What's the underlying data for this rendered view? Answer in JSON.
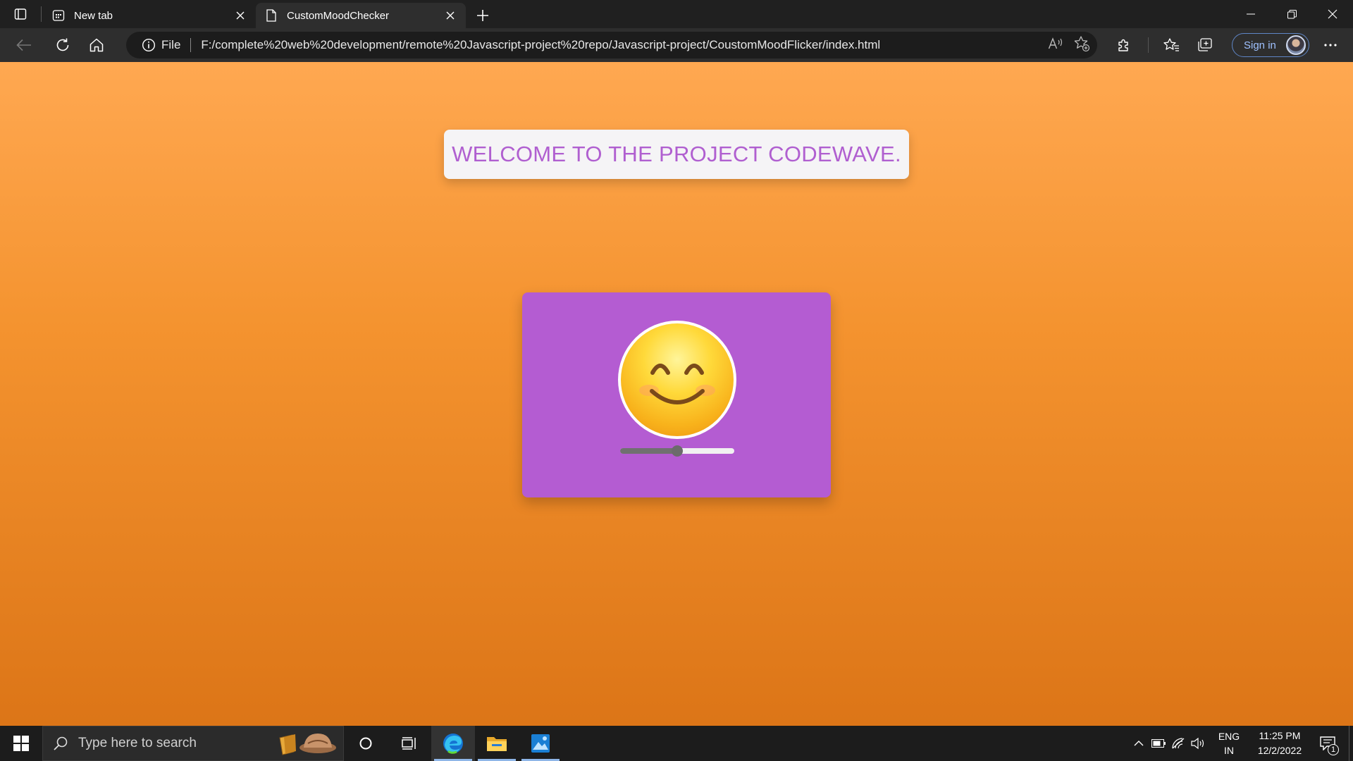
{
  "browser": {
    "tabs": [
      {
        "title": "New tab",
        "icon": "new-tab-page-icon",
        "active": false
      },
      {
        "title": "CustomMoodChecker",
        "icon": "document-icon",
        "active": true
      }
    ],
    "address": {
      "scheme_label": "File",
      "url": "F:/complete%20web%20development/remote%20Javascript-project%20repo/Javascript-project/CoustomMoodFlicker/index.html"
    },
    "sign_in_label": "Sign in"
  },
  "page": {
    "welcome_text": "WELCOME TO THE PROJECT CODEWAVE.",
    "mood_emoji": "smiling-face-with-smiling-eyes",
    "mood_slider_value": 0.5,
    "colors": {
      "background_top": "#ffa851",
      "background_bottom": "#dc7517",
      "card": "#b45cd2",
      "heading_text": "#b05fd0"
    }
  },
  "taskbar": {
    "search_placeholder": "Type here to search",
    "language": {
      "line1": "ENG",
      "line2": "IN"
    },
    "clock": {
      "time": "11:25 PM",
      "date": "12/2/2022"
    },
    "notification_count": "1"
  }
}
